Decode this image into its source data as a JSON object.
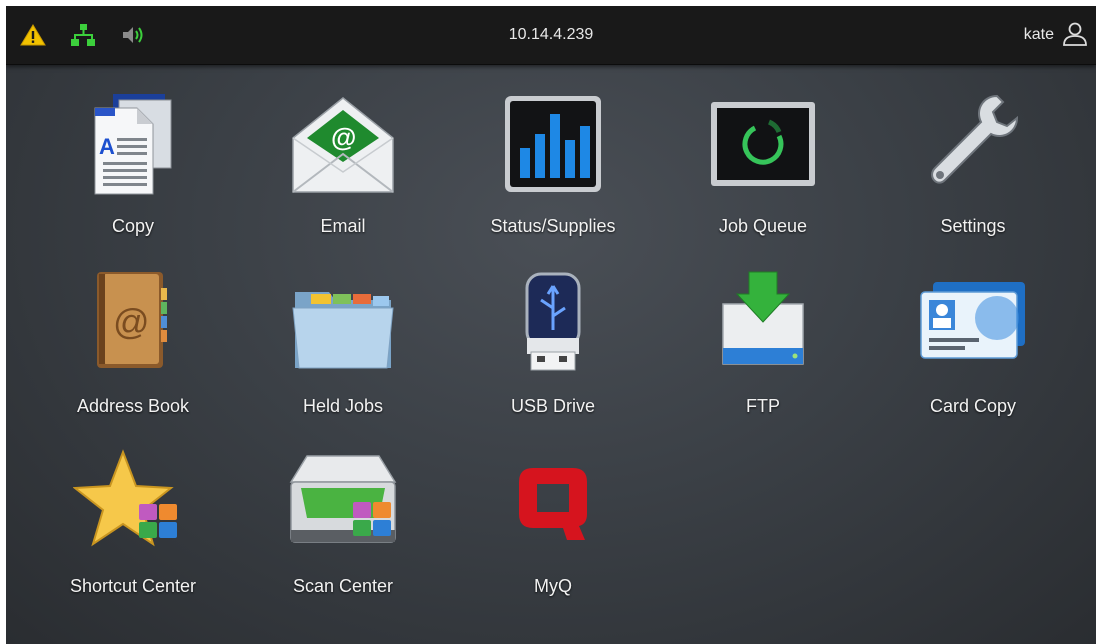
{
  "status_bar": {
    "ip_address": "10.14.4.239",
    "username": "kate",
    "icons": [
      "warning-icon",
      "network-icon",
      "speaker-icon",
      "user-icon"
    ]
  },
  "apps": [
    {
      "label": "Copy",
      "icon": "copy-icon"
    },
    {
      "label": "Email",
      "icon": "email-icon"
    },
    {
      "label": "Status/Supplies",
      "icon": "status-supplies-icon"
    },
    {
      "label": "Job Queue",
      "icon": "job-queue-icon"
    },
    {
      "label": "Settings",
      "icon": "wrench-icon"
    },
    {
      "label": "Address Book",
      "icon": "address-book-icon"
    },
    {
      "label": "Held Jobs",
      "icon": "folder-icon"
    },
    {
      "label": "USB Drive",
      "icon": "usb-drive-icon"
    },
    {
      "label": "FTP",
      "icon": "ftp-icon"
    },
    {
      "label": "Card Copy",
      "icon": "id-card-icon"
    },
    {
      "label": "Shortcut Center",
      "icon": "star-icon"
    },
    {
      "label": "Scan Center",
      "icon": "scanner-icon"
    },
    {
      "label": "MyQ",
      "icon": "myq-logo-icon"
    }
  ],
  "colors": {
    "warning": "#f2c200",
    "network": "#3ccf3c",
    "myq_red": "#d6141e",
    "bar_blue": "#1e88e5"
  }
}
